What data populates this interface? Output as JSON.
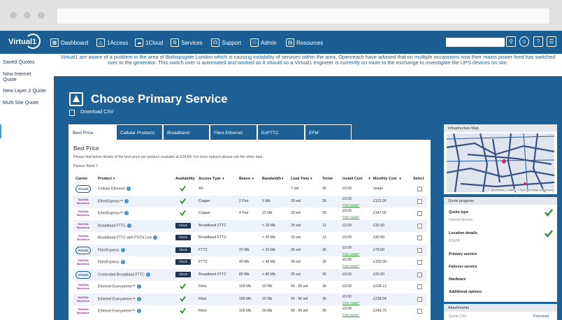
{
  "app": {
    "logo_text": "Virtual1"
  },
  "nav": {
    "items": [
      {
        "label": "Dashboard",
        "icon": "dashboard-icon"
      },
      {
        "label": "1Access",
        "icon": "triangle-icon"
      },
      {
        "label": "1Cloud",
        "icon": "cloud-icon"
      },
      {
        "label": "Services",
        "icon": "services-icon"
      },
      {
        "label": "Support",
        "icon": "headset-icon"
      },
      {
        "label": "Admin",
        "icon": "admin-icon"
      },
      {
        "label": "Resources",
        "icon": "resources-icon"
      }
    ],
    "right_icons": [
      "search-icon",
      "smiley-icon",
      "help-icon",
      "menu-icon"
    ]
  },
  "sidebar": {
    "items": [
      {
        "label": "Saved Quotes"
      },
      {
        "label": "New Internet Quote"
      },
      {
        "label": "New Layer 2 Quote"
      },
      {
        "label": "Multi Site Quote"
      }
    ],
    "active_index": 1
  },
  "alert": {
    "text": "Virtual1 are aware of a problem in the area of Bishopsgate London which is causing instability of services within the area. Openreach have advised that on multiple occassions now their mains power feed has switched over to the generator. This switch over is automated and worked as it should so a Virtual1 engineer is currently on route to the exchange to investigate the UPS devices on site."
  },
  "page": {
    "title": "Choose Primary Service",
    "download_csv": "Download CSV"
  },
  "tabs": [
    {
      "label": "Best Price",
      "active": true
    },
    {
      "label": "Cellular Products"
    },
    {
      "label": "Broadband"
    },
    {
      "label": "Fibre Ethernet"
    },
    {
      "label": "EoFTTC"
    },
    {
      "label": "EFM"
    }
  ],
  "panel": {
    "heading": "Best Price",
    "description": "Please find below details of the best price per product available at E34JW. For more options please use the other tabs.",
    "partner_band": "Partner Band 2"
  },
  "table": {
    "columns": [
      "Carrier",
      "Product",
      "Availability",
      "Access Type",
      "Bearer",
      "Bandwidth",
      "Lead Time",
      "Term",
      "Install Cost",
      "Monthly Cost",
      "Select"
    ],
    "free_router_label": "Free router*",
    "check_label": "Check",
    "rows": [
      {
        "carrier": "Virtual1",
        "product": "Cellular Ethernet",
        "availability": "tick",
        "access": "4G",
        "bearer": "",
        "bandwidth": "",
        "lead": "7 wd",
        "term": "36",
        "install": "£0.00",
        "free": false,
        "monthly": "usage"
      },
      {
        "carrier": "TalkTalk Business",
        "product": "EtherExpress™",
        "availability": "tick",
        "access": "Copper",
        "bearer": "2 Pair",
        "bandwidth": "5 Mb",
        "lead": "30 wd",
        "term": "36",
        "install": "£0.00",
        "free": true,
        "monthly": "£122.00"
      },
      {
        "carrier": "TalkTalk Business",
        "product": "EtherExpress™",
        "availability": "tick",
        "access": "Copper",
        "bearer": "4 Pair",
        "bandwidth": "15 Mb",
        "lead": "30 wd",
        "term": "36",
        "install": "£0.00",
        "free": true,
        "monthly": "£147.00"
      },
      {
        "carrier": "TalkTalk Business",
        "product": "Broadband FTTC",
        "availability": "check",
        "access": "Broadband FTTC",
        "bearer": "",
        "bandwidth": "< 20 Mb",
        "lead": "25 wd",
        "term": "12",
        "install": "£0.00",
        "free": false,
        "monthly": "£30.00"
      },
      {
        "carrier": "TalkTalk Business",
        "product": "Broadband FTTC with PSTN Line",
        "availability": "check",
        "access": "Broadband FTTC",
        "bearer": "",
        "bandwidth": "< 20 Mb",
        "lead": "25 wd",
        "term": "12",
        "install": "£0.00",
        "free": false,
        "monthly": "£40.00"
      },
      {
        "carrier": "Virtual1",
        "product": "FibreExpress",
        "availability": "check",
        "access": "FTTC",
        "bearer": "20 Mb",
        "bandwidth": "< 20 Mb",
        "lead": "30 wd",
        "term": "36",
        "install": "£0.00",
        "free": true,
        "monthly": "£79.00"
      },
      {
        "carrier": "TalkTalk Business",
        "product": "FibreExpress",
        "availability": "check",
        "access": "FTTC",
        "bearer": "40 Mb",
        "bandwidth": "< 40 Mb",
        "lead": "30 wd",
        "term": "36",
        "install": "£0.00",
        "free": true,
        "monthly": "£100.00"
      },
      {
        "carrier": "Virtual1",
        "product": "Contended Broadband FTTC",
        "availability": "check",
        "access": "Broadband FTTC",
        "bearer": "80 Mb",
        "bandwidth": "< 80 Mb",
        "lead": "25 wd",
        "term": "36",
        "install": "£0.00",
        "free": false,
        "monthly": "£30.00"
      },
      {
        "carrier": "TalkTalk Business",
        "product": "Ethernet Everywhere™",
        "availability": "tick",
        "access": "Fibre",
        "bearer": "100 Mb",
        "bandwidth": "10 Mb",
        "lead": "55 - 90 wd",
        "term": "36",
        "install": "£0.00",
        "free": false,
        "monthly": "£228.13"
      },
      {
        "carrier": "TalkTalk Business",
        "product": "Ethernet Everywhere™",
        "availability": "tick",
        "access": "Fibre",
        "bearer": "100 Mb",
        "bandwidth": "20 Mb",
        "lead": "55 - 90 wd",
        "term": "36",
        "install": "£0.00",
        "free": true,
        "monthly": "£238.54"
      },
      {
        "carrier": "TalkTalk Business",
        "product": "Ethernet Everywhere™",
        "availability": "tick",
        "access": "Fibre",
        "bearer": "100 Mb",
        "bandwidth": "30 Mb",
        "lead": "55 - 90 wd",
        "term": "36",
        "install": "£0.00",
        "free": true,
        "monthly": "£243.75"
      }
    ]
  },
  "map": {
    "title": "Infrastructure Map",
    "attribution": "© OpenReach | Leaflet | © OpenStreetMap contributors"
  },
  "progress": {
    "title": "Quote progress",
    "items": [
      {
        "label": "Quote type",
        "value": "Internet Access",
        "done": true
      },
      {
        "label": "Location details",
        "value": "E34JW",
        "done": true
      },
      {
        "label": "Primary service",
        "value": "",
        "done": false
      },
      {
        "label": "Failover service",
        "value": "",
        "done": false
      },
      {
        "label": "Hardware",
        "value": "",
        "done": false
      },
      {
        "label": "Additional options",
        "value": "",
        "done": false
      }
    ]
  },
  "attachments": {
    "title": "Attachments",
    "row_label": "Quote CSV",
    "download": "Download"
  },
  "colors": {
    "brand_blue": "#1b5e94",
    "main_bg": "#1c6096",
    "tick_green": "#2a8c2a",
    "check_btn": "#1c3352"
  }
}
